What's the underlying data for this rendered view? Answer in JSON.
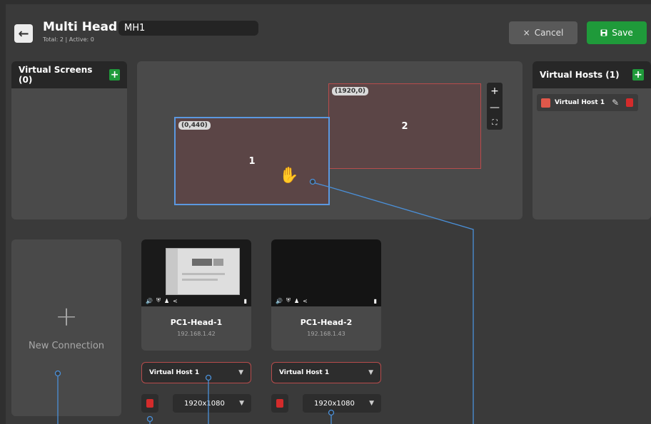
{
  "header": {
    "title": "Multi Head /",
    "name_value": "MH1",
    "subtitle": "Total: 2 | Active: 0",
    "cancel_label": "Cancel",
    "save_label": "Save"
  },
  "virtual_screens": {
    "title": "Virtual Screens (0)"
  },
  "virtual_hosts": {
    "title": "Virtual Hosts (1)",
    "items": [
      {
        "label": "Virtual Host 1",
        "color": "#e0584a"
      }
    ]
  },
  "canvas": {
    "screens": [
      {
        "id": "1",
        "coord": "(0,440)"
      },
      {
        "id": "2",
        "coord": "(1920,0)"
      }
    ]
  },
  "new_connection": {
    "label": "New Connection"
  },
  "connections": [
    {
      "name": "PC1-Head-1",
      "ip": "192.168.1.42",
      "host": "Virtual Host 1",
      "resolution": "1920x1080"
    },
    {
      "name": "PC1-Head-2",
      "ip": "192.168.1.43",
      "host": "Virtual Host 1",
      "resolution": "1920x1080"
    }
  ],
  "colors": {
    "accent_green": "#1f9a3a",
    "danger_red": "#d42b2b",
    "link_blue": "#4a90d9",
    "screen_border": "#b84c4c"
  }
}
